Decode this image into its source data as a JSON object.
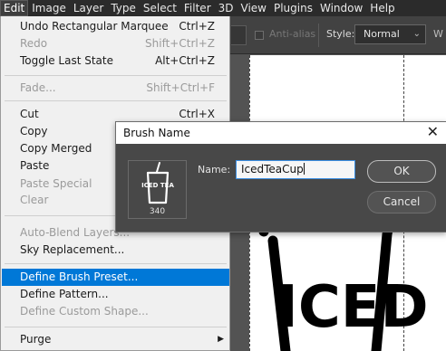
{
  "menubar": {
    "items": [
      "Edit",
      "Image",
      "Layer",
      "Type",
      "Select",
      "Filter",
      "3D",
      "View",
      "Plugins",
      "Window",
      "Help"
    ],
    "active": "Edit"
  },
  "options_bar": {
    "anti_alias_label": "Anti-alias",
    "style_label": "Style:",
    "style_value": "Normal",
    "trailing_label": "W"
  },
  "edit_menu": {
    "items": [
      {
        "label": "Undo Rectangular Marquee",
        "shortcut": "Ctrl+Z",
        "disabled": false
      },
      {
        "label": "Redo",
        "shortcut": "Shift+Ctrl+Z",
        "disabled": true
      },
      {
        "label": "Toggle Last State",
        "shortcut": "Alt+Ctrl+Z",
        "disabled": false
      },
      {
        "label": "Fade...",
        "shortcut": "Shift+Ctrl+F",
        "disabled": true
      },
      {
        "label": "Cut",
        "shortcut": "Ctrl+X",
        "disabled": false
      },
      {
        "label": "Copy",
        "shortcut": "",
        "disabled": false
      },
      {
        "label": "Copy Merged",
        "shortcut": "",
        "disabled": false
      },
      {
        "label": "Paste",
        "shortcut": "",
        "disabled": false
      },
      {
        "label": "Paste Special",
        "shortcut": "",
        "disabled": true
      },
      {
        "label": "Clear",
        "shortcut": "",
        "disabled": true
      },
      {
        "label": "Auto-Blend Layers...",
        "shortcut": "",
        "disabled": true
      },
      {
        "label": "Sky Replacement...",
        "shortcut": "",
        "disabled": false
      },
      {
        "label": "Define Brush Preset...",
        "shortcut": "",
        "disabled": false,
        "highlighted": true
      },
      {
        "label": "Define Pattern...",
        "shortcut": "",
        "disabled": false
      },
      {
        "label": "Define Custom Shape...",
        "shortcut": "",
        "disabled": true
      },
      {
        "label": "Purge",
        "shortcut": "",
        "disabled": false,
        "submenu": true
      }
    ]
  },
  "dialog": {
    "title": "Brush Name",
    "close_glyph": "✕",
    "thumbnail_text": "ICED TEA",
    "brush_size": "340",
    "name_label": "Name:",
    "name_value": "IcedTeaCup",
    "ok_label": "OK",
    "cancel_label": "Cancel"
  },
  "canvas": {
    "artwork_text": "ICED"
  },
  "colors": {
    "menubar_bg": "#2b2b2b",
    "menu_highlight": "#0078d7",
    "dialog_body": "#484848",
    "input_focus": "#3b8ee2"
  }
}
